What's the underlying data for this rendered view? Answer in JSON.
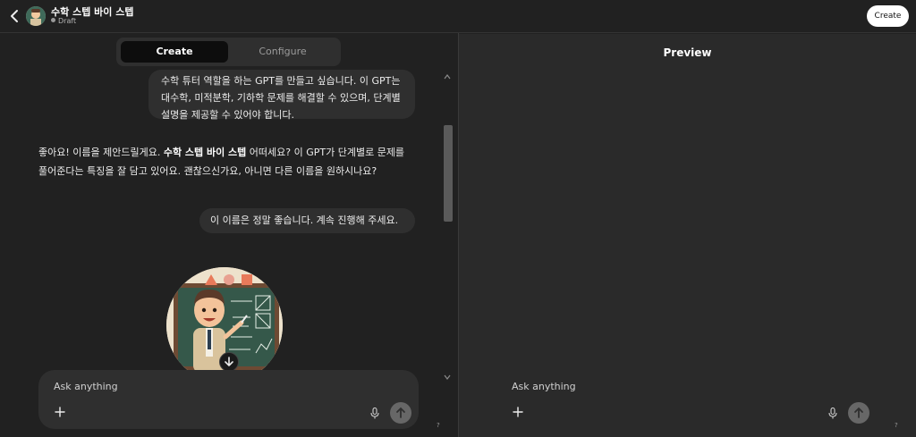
{
  "header": {
    "gpt_name": "수학 스텝 바이 스텝",
    "status": "Draft",
    "create_button": "Create"
  },
  "builder": {
    "tabs": [
      {
        "label": "Create",
        "active": true
      },
      {
        "label": "Configure",
        "active": false
      }
    ],
    "messages": {
      "user_1": "수학 튜터 역할을 하는 GPT를 만들고 싶습니다. 이 GPT는 대수학, 미적분학, 기하학 문제를 해결할 수 있으며, 단계별 설명을 제공할 수 있어야 합니다.",
      "assistant_1_prefix": "좋아요! 이름을 제안드릴게요.",
      "assistant_1_name": "수학 스텝 바이 스텝",
      "assistant_1_suffix": "어떠세요? 이 GPT가 단계별로 문제를 풀어준다는 특징을 잘 담고 있어요. 괜찮으신가요, 아니면 다른 이름을 원하시나요?",
      "user_2": "이 이름은 정말 좋습니다. 계속 진행해 주세요."
    },
    "composer": {
      "placeholder": "Ask anything"
    },
    "help_label": "?"
  },
  "preview": {
    "title": "Preview",
    "composer": {
      "placeholder": "Ask anything"
    },
    "help_label": "?"
  },
  "colors": {
    "background": "#212121",
    "preview_background": "#2a2a2a",
    "bubble": "#2f2f2f",
    "accent_white": "#ffffff"
  },
  "icons": [
    "back-arrow-icon",
    "plus-icon",
    "microphone-icon",
    "send-arrow-icon",
    "arrow-down-icon"
  ]
}
